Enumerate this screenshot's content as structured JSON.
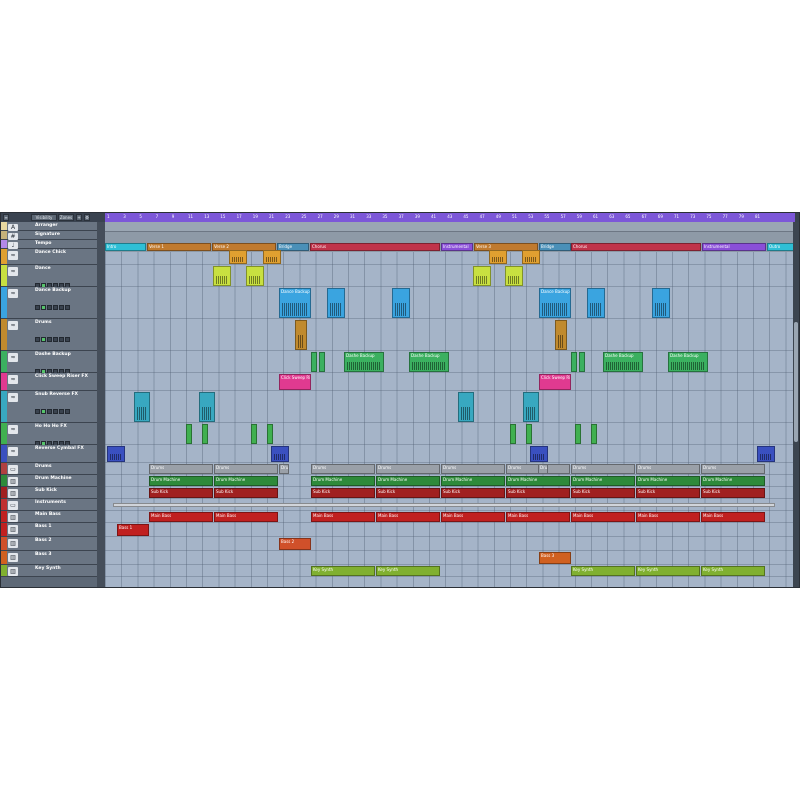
{
  "toolbar": {
    "buttons": [
      "Visibility",
      "Zones"
    ]
  },
  "ruler": {
    "bars": [
      "1",
      "3",
      "5",
      "7",
      "9",
      "11",
      "13",
      "15",
      "17",
      "19",
      "21",
      "23",
      "25",
      "27",
      "29",
      "31",
      "33",
      "35",
      "37",
      "39",
      "41",
      "43",
      "45",
      "47",
      "49",
      "51",
      "53",
      "55",
      "57",
      "59",
      "61",
      "63",
      "65",
      "67",
      "69",
      "71",
      "73",
      "75",
      "77",
      "79",
      "81"
    ]
  },
  "arranger": {
    "items": [
      {
        "label": "Intro",
        "color": "#2fbfd6"
      },
      {
        "label": "Verse 1",
        "color": "#c07a2e"
      },
      {
        "label": "Verse 2",
        "color": "#c07a2e"
      },
      {
        "label": "Bridge",
        "color": "#4a90b8"
      },
      {
        "label": "Chorus",
        "color": "#c0334a"
      },
      {
        "label": "Instrumental",
        "color": "#8a4fd8"
      },
      {
        "label": "Verse 3",
        "color": "#c07a2e"
      },
      {
        "label": "Bridge",
        "color": "#4a90b8"
      },
      {
        "label": "Chorus",
        "color": "#c0334a"
      },
      {
        "label": "Instrumental",
        "color": "#8a4fd8"
      },
      {
        "label": "Outro",
        "color": "#2fbfd6"
      }
    ]
  },
  "tracks": [
    {
      "name": "Arranger",
      "color": "#e8d8a0",
      "icon": "arranger-icon"
    },
    {
      "name": "Signature",
      "color": "#c6b27a",
      "icon": "signature-icon"
    },
    {
      "name": "Tempo",
      "color": "#b388e8",
      "icon": "tempo-icon"
    },
    {
      "name": "Dance Chick",
      "color": "#e0a030",
      "icon": "audio-icon"
    },
    {
      "name": "Dance",
      "color": "#c8e040",
      "icon": "audio-icon"
    },
    {
      "name": "Dance Backup",
      "color": "#3aa4e0",
      "icon": "audio-icon"
    },
    {
      "name": "Drums",
      "color": "#c08a2e",
      "icon": "audio-icon"
    },
    {
      "name": "Dashe Backup",
      "color": "#3bb060",
      "icon": "audio-icon"
    },
    {
      "name": "Click Sweep Riser FX",
      "color": "#e03a90",
      "icon": "audio-icon"
    },
    {
      "name": "Snub Reverse FX",
      "color": "#38a8c0",
      "icon": "audio-icon"
    },
    {
      "name": "Ho Ho Ho FX",
      "color": "#40b050",
      "icon": "audio-icon"
    },
    {
      "name": "Reverse Cymbal FX",
      "color": "#3a50c0",
      "icon": "audio-icon"
    },
    {
      "name": "Drums",
      "color": "#b04040",
      "icon": "folder-icon"
    },
    {
      "name": "Drum Machine",
      "color": "#2e8a3a",
      "icon": "instrument-icon"
    },
    {
      "name": "Sub Kick",
      "color": "#a02020",
      "icon": "instrument-icon"
    },
    {
      "name": "Instruments",
      "color": "#c03030",
      "icon": "folder-icon"
    },
    {
      "name": "Main Bass",
      "color": "#c02020",
      "icon": "instrument-icon"
    },
    {
      "name": "Bass 1",
      "color": "#c02020",
      "icon": "instrument-icon"
    },
    {
      "name": "Bass 2",
      "color": "#d0502a",
      "icon": "instrument-icon"
    },
    {
      "name": "Bass 3",
      "color": "#d06020",
      "icon": "instrument-icon"
    },
    {
      "name": "Key Synth",
      "color": "#80b030",
      "icon": "instrument-icon"
    }
  ],
  "events": {
    "dance_chick": "Dance Chick",
    "dance": "Dance",
    "dance_backup": "Dance Backup",
    "drums_audio": "Drums",
    "dashe_backup": "Dashe Backup",
    "click_sweep": "Click Sweep Rise",
    "drums_folder": "Drums",
    "drum_machine": "Drum Machine",
    "sub_kick": "Sub Kick",
    "main_bass": "Main Bass",
    "bass1": "Bass 1",
    "bass2": "Bass 2",
    "bass3": "Bass 3",
    "key_synth": "Key Synth"
  },
  "colors": {
    "ruler": "#7c57d8",
    "background": "#a5b4c8"
  }
}
